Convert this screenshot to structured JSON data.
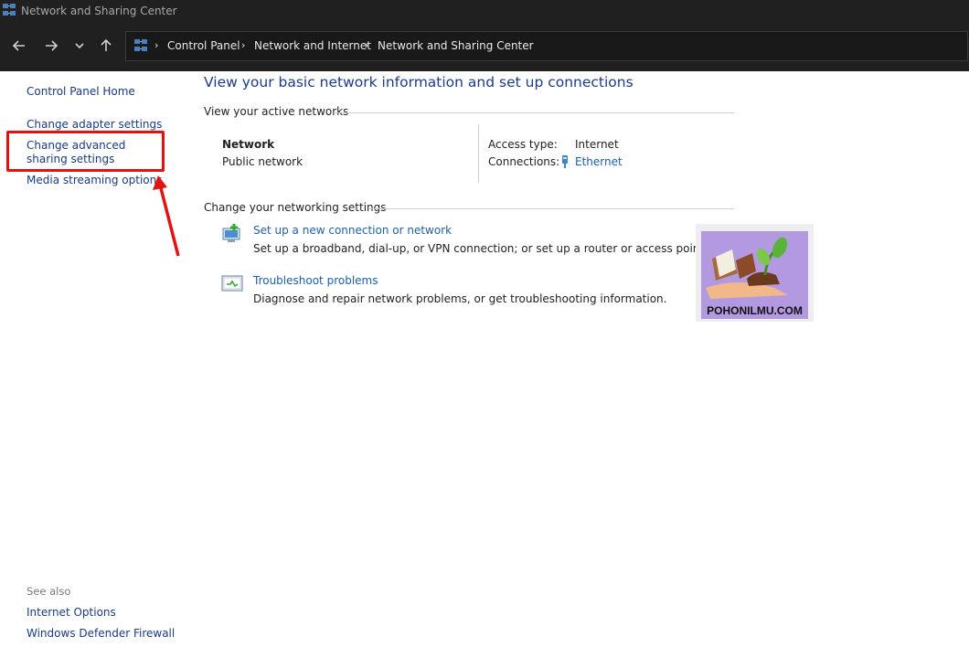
{
  "window": {
    "title": "Network and Sharing Center"
  },
  "breadcrumb": [
    "Control Panel",
    "Network and Internet",
    "Network and Sharing Center"
  ],
  "left_pane": {
    "links": [
      "Control Panel Home",
      "Change adapter settings",
      "Change advanced sharing settings",
      "Media streaming options"
    ],
    "see_also_label": "See also",
    "see_also_links": [
      "Internet Options",
      "Windows Defender Firewall"
    ]
  },
  "main": {
    "heading": "View your basic network information and set up connections",
    "active_networks_label": "View your active networks",
    "network": {
      "name": "Network",
      "type": "Public network",
      "access_type_label": "Access type:",
      "access_type_value": "Internet",
      "connections_label": "Connections:",
      "connections_value": "Ethernet"
    },
    "change_settings_label": "Change your networking settings",
    "tasks": [
      {
        "title": "Set up a new connection or network",
        "description": "Set up a broadband, dial-up, or VPN connection; or set up a router or access point."
      },
      {
        "title": "Troubleshoot problems",
        "description": "Diagnose and repair network problems, or get troubleshooting information."
      }
    ]
  },
  "watermark": {
    "text": "POHONILMU.COM"
  },
  "colors": {
    "link": "#1f5fa8",
    "heading": "#1c3a8c",
    "highlight": "#e21212",
    "titlebar": "#202020"
  }
}
